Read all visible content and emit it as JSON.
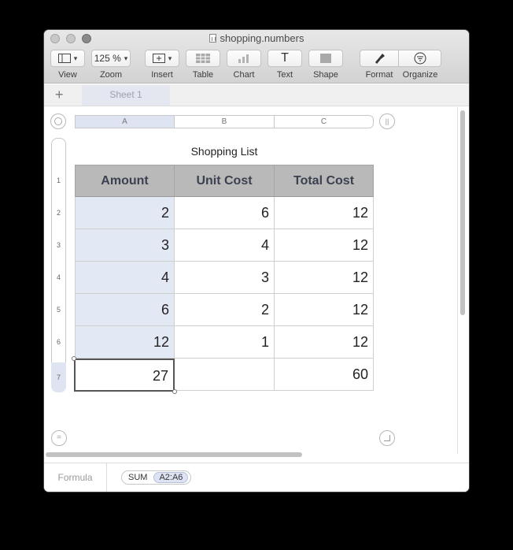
{
  "window": {
    "title": "shopping.numbers"
  },
  "toolbar": {
    "view": {
      "label": "View"
    },
    "zoom": {
      "label": "Zoom",
      "value": "125 %"
    },
    "insert": {
      "label": "Insert"
    },
    "table": {
      "label": "Table"
    },
    "chart": {
      "label": "Chart"
    },
    "text": {
      "label": "Text",
      "glyph": "T"
    },
    "shape": {
      "label": "Shape"
    },
    "format": {
      "label": "Format"
    },
    "organize": {
      "label": "Organize"
    }
  },
  "tabs": {
    "add": "+",
    "sheets": [
      "Sheet 1"
    ]
  },
  "columns": [
    "A",
    "B",
    "C"
  ],
  "rows": [
    "1",
    "2",
    "3",
    "4",
    "5",
    "6",
    "7"
  ],
  "table": {
    "title": "Shopping List",
    "headers": [
      "Amount",
      "Unit Cost",
      "Total Cost"
    ],
    "data": [
      [
        "2",
        "6",
        "12"
      ],
      [
        "3",
        "4",
        "12"
      ],
      [
        "4",
        "3",
        "12"
      ],
      [
        "6",
        "2",
        "12"
      ],
      [
        "12",
        "1",
        "12"
      ]
    ],
    "footer": [
      "27",
      "",
      "60"
    ]
  },
  "formula": {
    "label": "Formula",
    "func": "SUM",
    "ref": "A2:A6"
  },
  "colors": {
    "selection": "#dfe4f2",
    "header_fill": "#b9b9b9"
  }
}
